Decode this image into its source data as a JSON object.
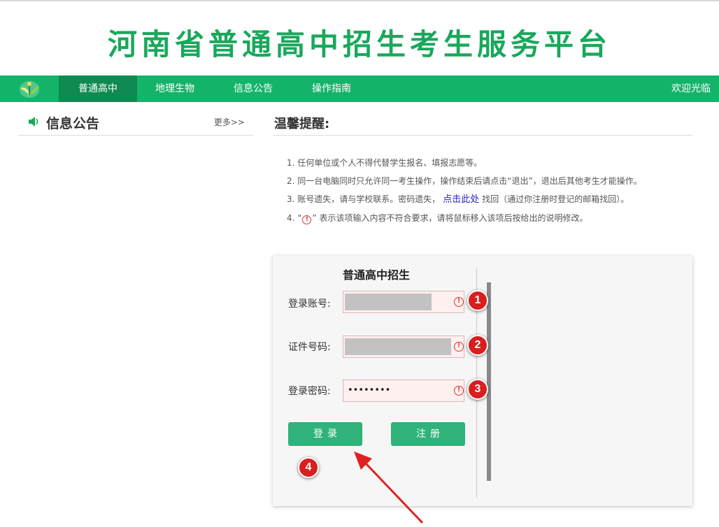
{
  "site_title": "河南省普通高中招生考生服务平台",
  "nav": {
    "items": [
      {
        "label": "普通高中",
        "active": true
      },
      {
        "label": "地理生物",
        "active": false
      },
      {
        "label": "信息公告",
        "active": false
      },
      {
        "label": "操作指南",
        "active": false
      }
    ],
    "welcome": "欢迎光临"
  },
  "notice": {
    "title": "信息公告",
    "more": "更多>>"
  },
  "tips": {
    "title": "温馨提醒:",
    "line1": "1. 任何单位或个人不得代替学生报名、填报志愿等。",
    "line2": "2. 同一台电脑同时只允许同一考生操作，操作结束后请点击“退出”，退出后其他考生才能操作。",
    "line3_pre": "3. 账号遗失，请与学校联系。密码遗失，",
    "line3_link": "点击此处",
    "line3_post": "找回（通过你注册时登记的邮箱找回）。",
    "line4_pre": "4. “",
    "line4_icon": "!",
    "line4_post": "” 表示该项输入内容不符合要求，请将鼠标移入该项后按给出的说明修改。"
  },
  "login": {
    "title": "普通高中招生",
    "account_label": "登录账号:",
    "id_label": "证件号码:",
    "password_label": "登录密码:",
    "password_value": "••••••••",
    "error_icon": "!",
    "login_button": "登录",
    "register_button": "注册",
    "badges": [
      "1",
      "2",
      "3",
      "4"
    ]
  },
  "colors": {
    "brand_green": "#14b36a",
    "title_green": "#19a85b",
    "button_green": "#2fb37a",
    "error_red": "#e03333",
    "badge_red": "#d91e1e"
  },
  "icons": [
    "logo-icon",
    "speaker-icon",
    "error-icon",
    "annotation-arrow-icon"
  ]
}
